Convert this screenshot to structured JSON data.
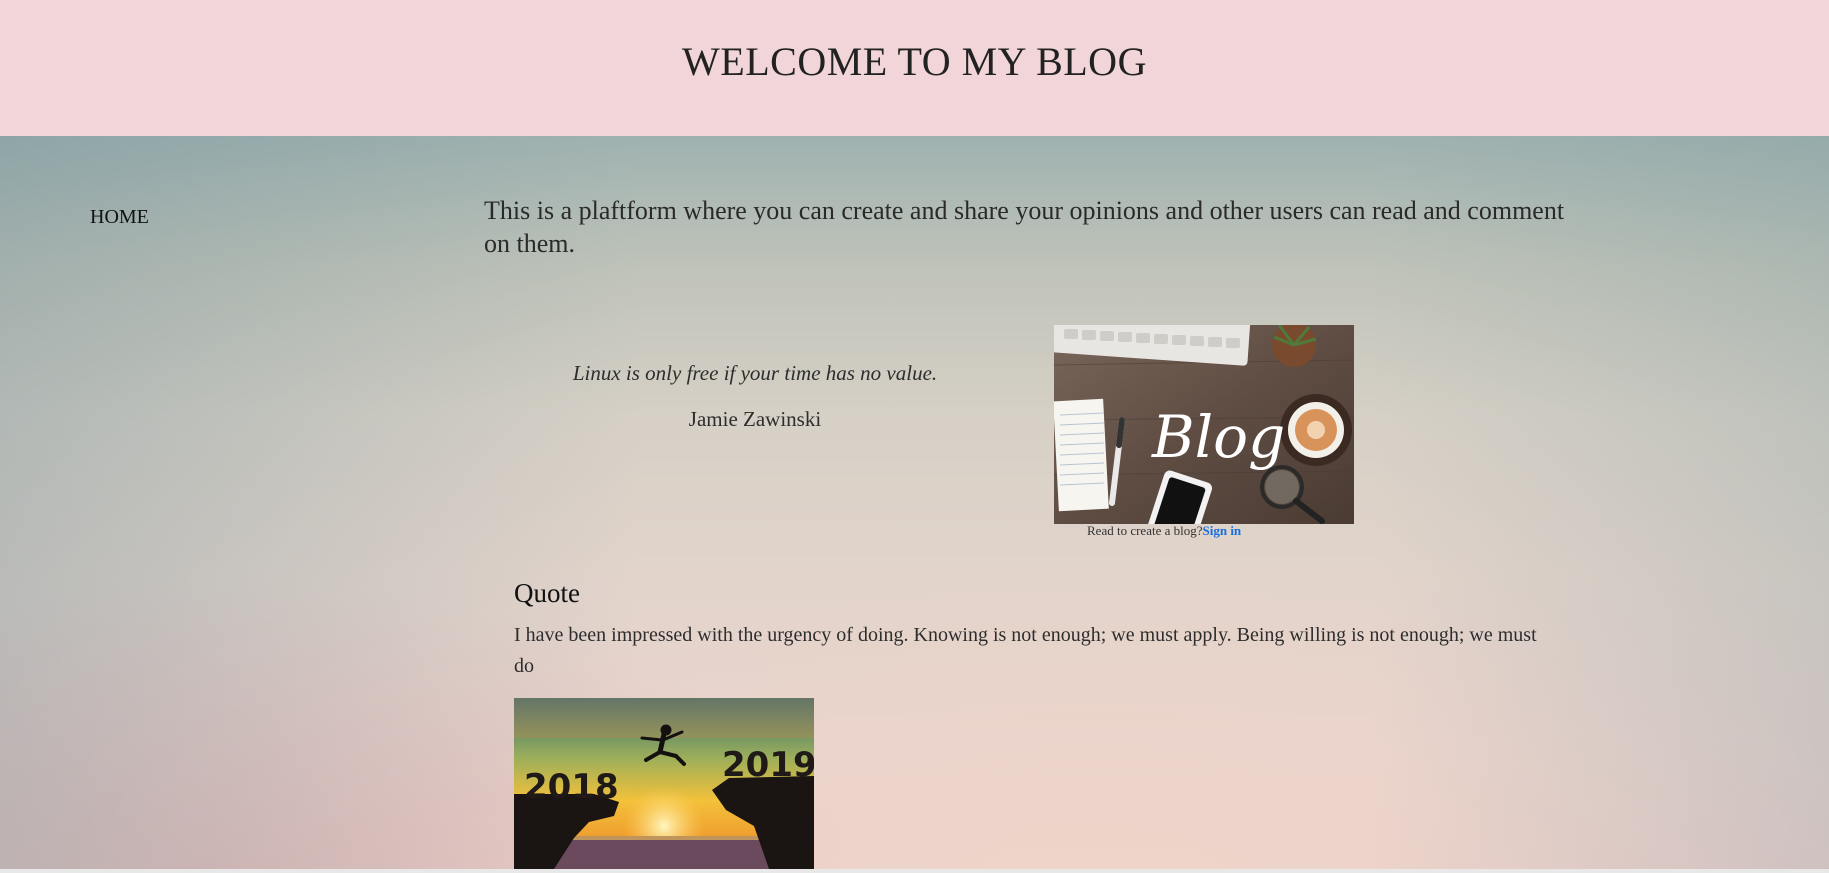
{
  "header": {
    "title": "WELCOME TO MY BLOG"
  },
  "nav": {
    "home_label": "HOME"
  },
  "main": {
    "intro": "This is a plaftform where you can create and share your opinions and other users can read and comment on them.",
    "featured_quote": {
      "text": "Linux is only free if your time has no value.",
      "author": "Jamie Zawinski"
    },
    "blog_image": {
      "label": "Blog",
      "icon": "blog-desk-photo"
    },
    "signin_prompt": {
      "text": "Read to create a blog?",
      "link_label": "Sign in"
    },
    "quote_section": {
      "title": "Quote",
      "text": "I have been impressed with the urgency of doing. Knowing is not enough; we must apply. Being willing is not enough; we must do"
    },
    "jump_image": {
      "year_left": "2018",
      "year_right": "2019"
    }
  },
  "colors": {
    "header_bg": "#f1d5d8",
    "link": "#1a6ee0"
  }
}
